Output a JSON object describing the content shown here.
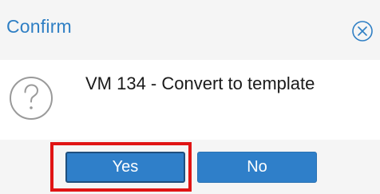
{
  "dialog": {
    "title": "Confirm",
    "close_icon": "close-circle-icon",
    "message_icon": "question-icon",
    "message": "VM 134 - Convert to template",
    "buttons": {
      "yes_label": "Yes",
      "no_label": "No"
    }
  },
  "colors": {
    "title": "#2f7fc4",
    "button": "#2f7fc9",
    "highlight": "#e01414",
    "header_bg": "#f5f5f5",
    "footer_bg": "#f5f5f5"
  }
}
